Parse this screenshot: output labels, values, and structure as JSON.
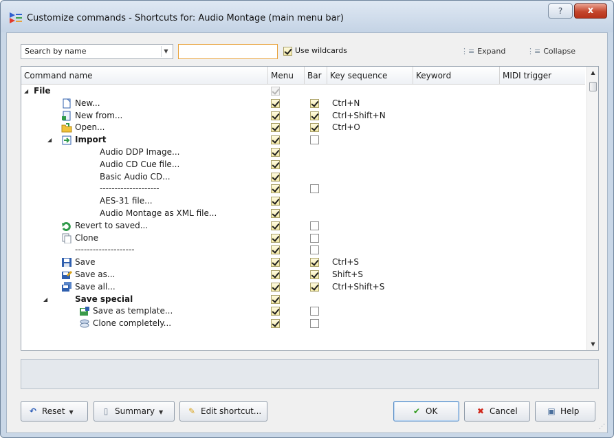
{
  "window": {
    "title": "Customize commands - Shortcuts for: Audio Montage (main menu bar)",
    "help_button": "?",
    "close_button": "x"
  },
  "toolbar": {
    "search_mode": "Search by name",
    "search_value": "",
    "use_wildcards_label": "Use wildcards",
    "use_wildcards_checked": true,
    "expand_label": "Expand",
    "collapse_label": "Collapse"
  },
  "grid": {
    "columns": [
      "Command name",
      "Menu",
      "Bar",
      "Key sequence",
      "Keyword",
      "MIDI trigger"
    ],
    "rows": [
      {
        "name": "File",
        "level": 0,
        "bold": true,
        "expander": "expanded",
        "icon": "",
        "menu": "dim",
        "bar": "",
        "key": ""
      },
      {
        "name": "New...",
        "level": 1,
        "bold": false,
        "expander": "",
        "icon": "new-document-icon",
        "menu": "on",
        "bar": "on",
        "key": "Ctrl+N"
      },
      {
        "name": "New from...",
        "level": 1,
        "bold": false,
        "expander": "",
        "icon": "new-from-template-icon",
        "menu": "on",
        "bar": "on",
        "key": "Ctrl+Shift+N"
      },
      {
        "name": "Open...",
        "level": 1,
        "bold": false,
        "expander": "",
        "icon": "open-folder-icon",
        "menu": "on",
        "bar": "on",
        "key": "Ctrl+O"
      },
      {
        "name": "Import",
        "level": 1,
        "bold": true,
        "expander": "expanded",
        "icon": "import-icon",
        "menu": "on",
        "bar": "off",
        "key": ""
      },
      {
        "name": "Audio DDP Image...",
        "level": 2,
        "bold": false,
        "expander": "",
        "icon": "",
        "menu": "on",
        "bar": "",
        "key": ""
      },
      {
        "name": "Audio CD Cue file...",
        "level": 2,
        "bold": false,
        "expander": "",
        "icon": "",
        "menu": "on",
        "bar": "",
        "key": ""
      },
      {
        "name": "Basic Audio CD...",
        "level": 2,
        "bold": false,
        "expander": "",
        "icon": "",
        "menu": "on",
        "bar": "",
        "key": ""
      },
      {
        "name": "--------------------",
        "level": 2,
        "bold": false,
        "expander": "",
        "icon": "",
        "menu": "on",
        "bar": "off",
        "key": ""
      },
      {
        "name": "AES-31 file...",
        "level": 2,
        "bold": false,
        "expander": "",
        "icon": "",
        "menu": "on",
        "bar": "",
        "key": ""
      },
      {
        "name": "Audio Montage as XML file...",
        "level": 2,
        "bold": false,
        "expander": "",
        "icon": "",
        "menu": "on",
        "bar": "",
        "key": ""
      },
      {
        "name": "Revert to saved...",
        "level": 1,
        "bold": false,
        "expander": "",
        "icon": "revert-icon",
        "menu": "on",
        "bar": "off",
        "key": ""
      },
      {
        "name": "Clone",
        "level": 1,
        "bold": false,
        "expander": "",
        "icon": "clone-icon",
        "menu": "on",
        "bar": "off",
        "key": ""
      },
      {
        "name": "--------------------",
        "level": 1,
        "bold": false,
        "expander": "",
        "icon": "",
        "menu": "on",
        "bar": "off",
        "key": ""
      },
      {
        "name": "Save",
        "level": 1,
        "bold": false,
        "expander": "",
        "icon": "save-icon",
        "menu": "on",
        "bar": "on",
        "key": "Ctrl+S"
      },
      {
        "name": "Save as...",
        "level": 1,
        "bold": false,
        "expander": "",
        "icon": "save-as-icon",
        "menu": "on",
        "bar": "on",
        "key": "Shift+S"
      },
      {
        "name": "Save all...",
        "level": 1,
        "bold": false,
        "expander": "",
        "icon": "save-all-icon",
        "menu": "on",
        "bar": "on",
        "key": "Ctrl+Shift+S"
      },
      {
        "name": "Save special",
        "level": 1,
        "bold": true,
        "expander": "expanded",
        "icon": "",
        "menu": "on",
        "bar": "",
        "key": ""
      },
      {
        "name": "Save as template...",
        "level": 2,
        "bold": false,
        "expander": "",
        "icon": "save-template-icon",
        "menu": "on",
        "bar": "off",
        "key": ""
      },
      {
        "name": "Clone completely...",
        "level": 2,
        "bold": false,
        "expander": "",
        "icon": "clone-completely-icon",
        "menu": "on",
        "bar": "off",
        "key": ""
      }
    ]
  },
  "buttons": {
    "reset": "Reset",
    "summary": "Summary",
    "edit_shortcut": "Edit shortcut...",
    "ok": "OK",
    "cancel": "Cancel",
    "help": "Help"
  },
  "colors": {
    "accent": "#e8a23a",
    "title_bar": "#c9d7e7",
    "close_red": "#c4452c",
    "ok_green": "#2f9a1c",
    "cancel_red": "#d0281b"
  }
}
